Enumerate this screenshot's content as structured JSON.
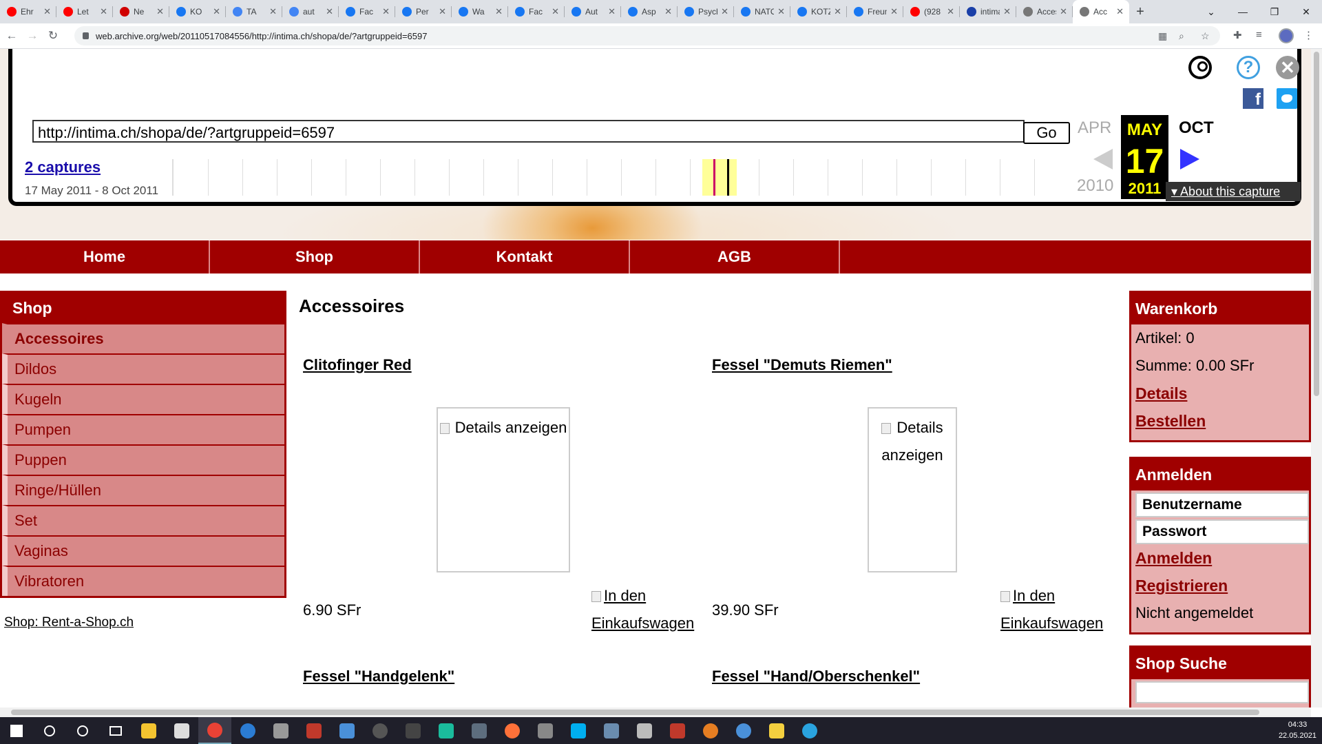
{
  "browser": {
    "tabs": [
      {
        "label": "Ehr",
        "icon": "youtube-icon",
        "color": "#ff0000"
      },
      {
        "label": "Let",
        "icon": "youtube-icon",
        "color": "#ff0000"
      },
      {
        "label": "Ne",
        "icon": "z-icon",
        "color": "#d00000"
      },
      {
        "label": "KO",
        "icon": "facebook-icon",
        "color": "#1877f2"
      },
      {
        "label": "TA",
        "icon": "google-icon",
        "color": "#4285f4"
      },
      {
        "label": "aut",
        "icon": "google-icon",
        "color": "#4285f4"
      },
      {
        "label": "Fac",
        "icon": "facebook-icon",
        "color": "#1877f2"
      },
      {
        "label": "Per",
        "icon": "facebook-icon",
        "color": "#1877f2"
      },
      {
        "label": "Wa",
        "icon": "facebook-icon",
        "color": "#1877f2"
      },
      {
        "label": "Fac",
        "icon": "facebook-icon",
        "color": "#1877f2"
      },
      {
        "label": "Aut",
        "icon": "facebook-icon",
        "color": "#1877f2"
      },
      {
        "label": "Asp",
        "icon": "facebook-icon",
        "color": "#1877f2"
      },
      {
        "label": "Psychol",
        "icon": "facebook-icon",
        "color": "#1877f2"
      },
      {
        "label": "NATO",
        "icon": "facebook-icon",
        "color": "#1877f2"
      },
      {
        "label": "KOTZ",
        "icon": "facebook-icon",
        "color": "#1877f2"
      },
      {
        "label": "Freunde",
        "icon": "facebook-icon",
        "color": "#1877f2"
      },
      {
        "label": "(928",
        "icon": "youtube-icon",
        "color": "#ff0000"
      },
      {
        "label": "intima.c",
        "icon": "s-icon",
        "color": "#1a3fa8"
      },
      {
        "label": "Access",
        "icon": "globe-icon",
        "color": "#777777"
      },
      {
        "label": "Acc",
        "icon": "globe-icon",
        "color": "#777777",
        "active": true
      }
    ],
    "url": "web.archive.org/web/20110517084556/http://intima.ch/shopa/de/?artgruppeid=6597"
  },
  "wayback": {
    "url_input": "http://intima.ch/shopa/de/?artgruppeid=6597",
    "go_label": "Go",
    "captures_label": "2 captures",
    "date_range": "17 May 2011 - 8 Oct 2011",
    "prev_month": "APR",
    "cur_month": "MAY",
    "next_month": "OCT",
    "cur_day": "17",
    "cur_year": "2011",
    "prev_year": "2010",
    "about_label": "About this capture"
  },
  "menu": [
    "Home",
    "Shop",
    "Kontakt",
    "AGB"
  ],
  "sidebar": {
    "title": "Shop",
    "items": [
      "Accessoires",
      "Dildos",
      "Kugeln",
      "Pumpen",
      "Puppen",
      "Ringe/Hüllen",
      "Set",
      "Vaginas",
      "Vibratoren"
    ],
    "footer_link": "Shop: Rent-a-Shop.ch"
  },
  "main": {
    "title": "Accessoires",
    "products": [
      {
        "name": "Clitofinger Red",
        "img_alt": "Details anzeigen",
        "price": "6.90 SFr",
        "cart_alt": "In den Einkaufswagen"
      },
      {
        "name": "Fessel \"Demuts Riemen\"",
        "img_alt": "Details anzeigen",
        "price": "39.90 SFr",
        "cart_alt": "In den Einkaufswagen"
      },
      {
        "name": "Fessel \"Handgelenk\""
      },
      {
        "name": "Fessel \"Hand/Oberschenkel\""
      }
    ]
  },
  "cart": {
    "title": "Warenkorb",
    "articles": "Artikel: 0",
    "sum": "Summe: 0.00 SFr",
    "details": "Details",
    "order": "Bestellen"
  },
  "login": {
    "title": "Anmelden",
    "username_placeholder": "Benutzername",
    "password_placeholder": "Passwort",
    "login_link": "Anmelden",
    "register_link": "Registrieren",
    "status": "Nicht angemeldet"
  },
  "search": {
    "title": "Shop Suche"
  },
  "clock": {
    "time": "04:33",
    "date": "22.05.2021"
  },
  "colors": {
    "brand": "#a00000",
    "sidebar_bg": "#d88888",
    "box_bg": "#e8b0b0",
    "link": "#8b0000"
  }
}
